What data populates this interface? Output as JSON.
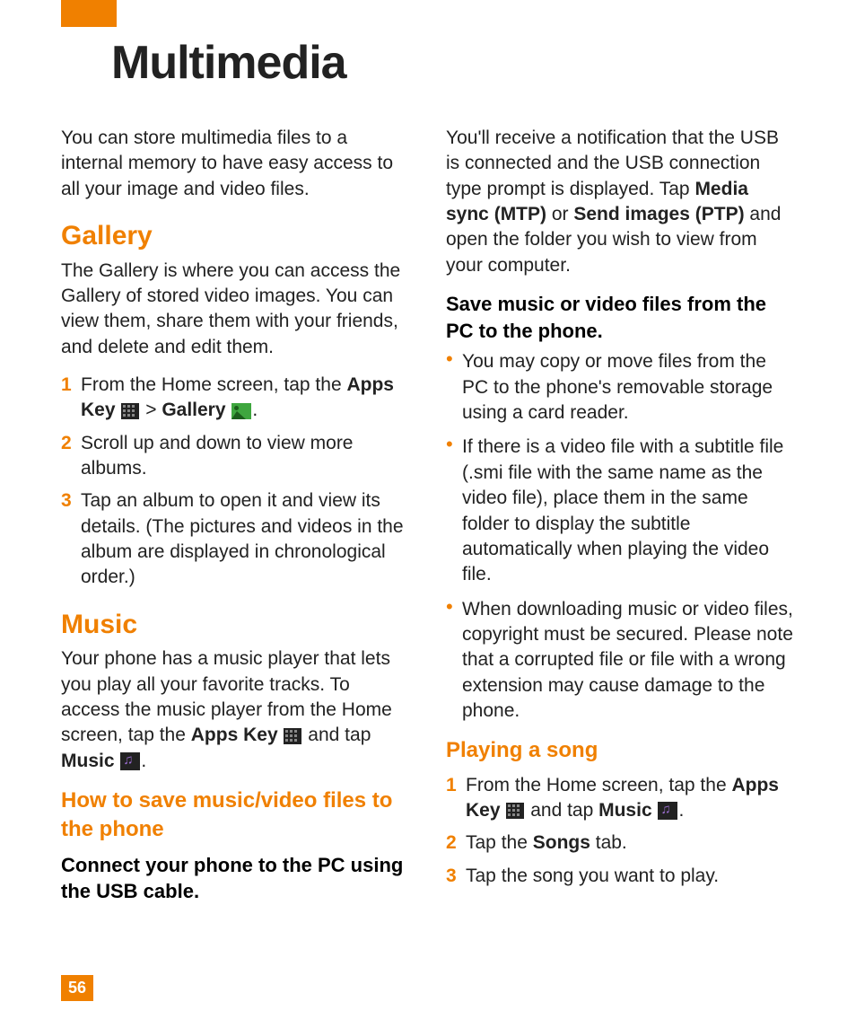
{
  "title": "Multimedia",
  "intro": "You can store multimedia files to a internal memory to have easy access to all your image and video files.",
  "gallery": {
    "heading": "Gallery",
    "intro": "The Gallery is where you can access the Gallery of stored video images. You can view them, share them with your friends, and delete and edit them.",
    "steps": {
      "s1_a": "From the Home screen, tap the ",
      "s1_apps": "Apps Key",
      "s1_gt": " > ",
      "s1_gallery": "Gallery",
      "s1_end": ".",
      "s2": "Scroll up and down to view more albums.",
      "s3": "Tap an album to open it and view its details. (The pictures and videos in the album are displayed in chronological order.)"
    }
  },
  "music": {
    "heading": "Music",
    "intro_a": "Your phone has a music player that lets you play all your favorite tracks. To access the music player from the Home screen, tap the ",
    "apps": "Apps Key",
    "intro_b": " and tap ",
    "music": "Music",
    "intro_c": "."
  },
  "saveto": {
    "heading": "How to save music/video files to the phone",
    "connect_h": "Connect your phone to the PC using the USB cable",
    "connect_dot": ".",
    "note_a": "You'll receive a notification that the USB is connected and the USB connection type prompt is displayed. Tap ",
    "mediasync": "Media sync (MTP)",
    "or": " or ",
    "sendimages": "Send images (PTP)",
    "note_b": " and open the folder you wish to view from your computer.",
    "save_h": "Save music or video files from the PC to the phone",
    "save_dot": ".",
    "bullets": {
      "b1": "You may copy or move files from the PC to the phone's removable storage using a card reader.",
      "b2": "If there is a video file with a subtitle file (.smi file with the same name as the video file), place them in the same folder to display the subtitle automatically when playing the video file.",
      "b3": "When downloading music or video files, copyright must be secured. Please note that a corrupted file or file with a wrong extension may cause damage to the phone."
    }
  },
  "playing": {
    "heading": "Playing a song",
    "s1_a": "From the Home screen, tap the ",
    "s1_apps": "Apps Key",
    "s1_b": " and tap ",
    "s1_music": "Music",
    "s1_c": ".",
    "s2_a": "Tap the ",
    "s2_songs": "Songs",
    "s2_b": " tab.",
    "s3": "Tap the song you want to play."
  },
  "page_number": "56"
}
